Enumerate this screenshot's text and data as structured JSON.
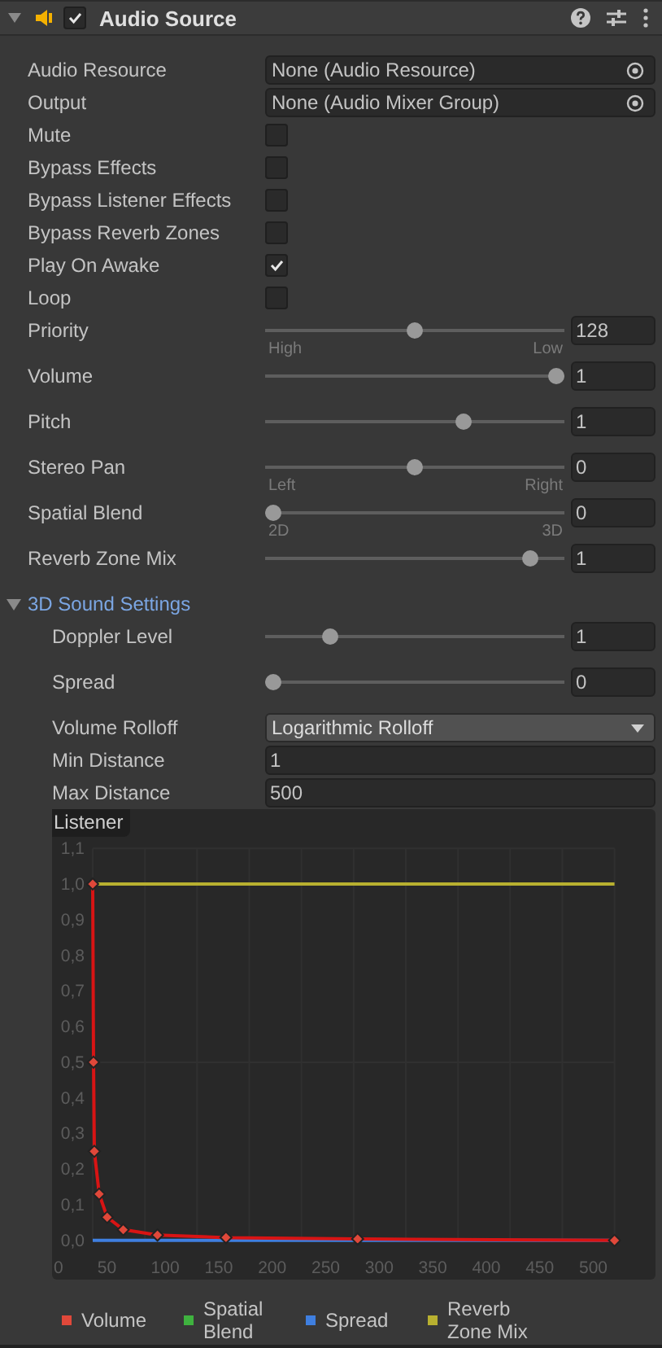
{
  "component": {
    "title": "Audio Source",
    "expanded": true,
    "enabled": true
  },
  "properties": [
    {
      "kind": "object",
      "label": "Audio Resource",
      "value": "None (Audio Resource)"
    },
    {
      "kind": "object",
      "label": "Output",
      "value": "None (Audio Mixer Group)"
    },
    {
      "kind": "checkbox",
      "label": "Mute",
      "checked": false
    },
    {
      "kind": "checkbox",
      "label": "Bypass Effects",
      "checked": false
    },
    {
      "kind": "checkbox",
      "label": "Bypass Listener Effects",
      "checked": false
    },
    {
      "kind": "checkbox",
      "label": "Bypass Reverb Zones",
      "checked": false
    },
    {
      "kind": "checkbox",
      "label": "Play On Awake",
      "checked": true
    },
    {
      "kind": "checkbox",
      "label": "Loop",
      "checked": false
    },
    {
      "kind": "slider",
      "label": "Priority",
      "level": 0.5,
      "value": "128",
      "min_label": "High",
      "max_label": "Low"
    },
    {
      "kind": "slider",
      "label": "Volume",
      "level": 1,
      "value": "1"
    },
    {
      "kind": "slider",
      "label": "Pitch",
      "level": 0.67,
      "value": "1"
    },
    {
      "kind": "slider",
      "label": "Stereo Pan",
      "level": 0.5,
      "value": "0",
      "min_label": "Left",
      "max_label": "Right"
    },
    {
      "kind": "slider",
      "label": "Spatial Blend",
      "level": 0,
      "value": "0",
      "min_label": "2D",
      "max_label": "3D"
    },
    {
      "kind": "slider",
      "label": "Reverb Zone Mix",
      "level": 0.91,
      "value": "1"
    }
  ],
  "sound_3d": {
    "title": "3D Sound Settings",
    "expanded": true,
    "properties": [
      {
        "kind": "slider",
        "label": "Doppler Level",
        "level": 0.2,
        "value": "1"
      },
      {
        "kind": "slider",
        "label": "Spread",
        "level": 0,
        "value": "0"
      },
      {
        "kind": "dropdown",
        "label": "Volume Rolloff",
        "value": "Logarithmic Rolloff"
      },
      {
        "kind": "number",
        "label": "Min Distance",
        "value": "1"
      },
      {
        "kind": "number",
        "label": "Max Distance",
        "value": "500"
      }
    ],
    "graph": {
      "label": "Listener",
      "chart_data": {
        "type": "line",
        "x": [
          36.5,
          37.2,
          38,
          42.5,
          50,
          65,
          97,
          161,
          284,
          524
        ],
        "series": [
          {
            "name": "Volume",
            "color": "#e0483a",
            "marker": "diamond",
            "values": [
              1,
              0.5,
              0.25,
              0.13,
              0.065,
              0.03,
              0.015,
              0.008,
              0.004,
              0
            ]
          },
          {
            "name": "Spatial Blend",
            "color": "#3fb23f",
            "values": [
              null,
              null,
              null,
              null,
              null,
              null,
              null,
              null,
              null,
              null
            ]
          },
          {
            "name": "Spread",
            "color": "#3f7fe0",
            "values": [
              0,
              0,
              0,
              0,
              0,
              0,
              0,
              0,
              0,
              0
            ]
          },
          {
            "name": "Reverb Zone Mix",
            "color": "#b8b030",
            "values": [
              1,
              1,
              1,
              1,
              1,
              1,
              1,
              1,
              1,
              1
            ]
          }
        ],
        "grid": true,
        "xlim": [
          -1.5,
          562.3
        ],
        "ylim": [
          -0.11,
          1.21
        ],
        "xticks": [
          0,
          50,
          100,
          150,
          200,
          250,
          300,
          350,
          400,
          450,
          500
        ],
        "yticks": [
          {
            "value": 0,
            "label": "0,0"
          },
          {
            "value": 0.1,
            "label": "0,1"
          },
          {
            "value": 0.2,
            "label": "0,2"
          },
          {
            "value": 0.3,
            "label": "0,3"
          },
          {
            "value": 0.4,
            "label": "0,4"
          },
          {
            "value": 0.5,
            "label": "0,5"
          },
          {
            "value": 0.6,
            "label": "0,6"
          },
          {
            "value": 0.7,
            "label": "0,7"
          },
          {
            "value": 0.8,
            "label": "0,8"
          },
          {
            "value": 0.9,
            "label": "0,9"
          },
          {
            "value": 1,
            "label": "1,0"
          },
          {
            "value": 1.1,
            "label": "1,1"
          }
        ]
      }
    }
  }
}
